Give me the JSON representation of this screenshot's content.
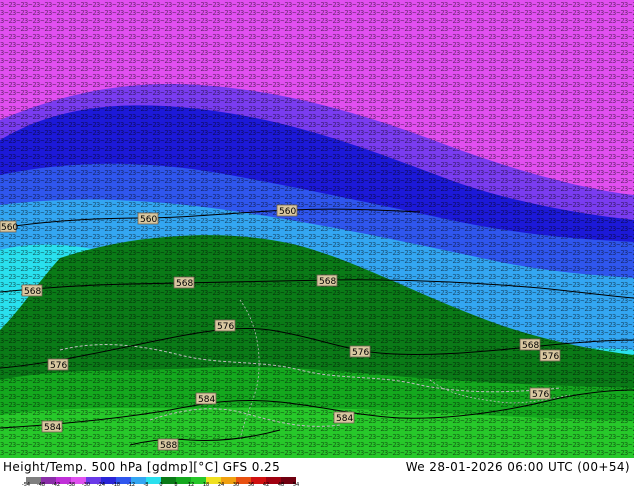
{
  "map": {
    "contour_labels": [
      "560",
      "560",
      "560",
      "568",
      "568",
      "568",
      "576",
      "576",
      "576",
      "576",
      "568",
      "576",
      "584",
      "584",
      "584",
      "588"
    ],
    "band_colors": {
      "magenta": "#e14ff0",
      "violet": "#7a3cf0",
      "blue_dark": "#1c19d8",
      "blue": "#2f56ee",
      "sky": "#33a6f2",
      "cyan": "#29e0ee",
      "green_dark": "#0a7a17",
      "green": "#14a81e",
      "green_light": "#27c82a"
    }
  },
  "footer": {
    "title_left": "Height/Temp. 500 hPa [gdmp][°C] GFS 0.25",
    "title_right": "We 28-01-2026 06:00 UTC (00+54)",
    "colorbar_ticks": [
      "-54",
      "-48",
      "-42",
      "-38",
      "-30",
      "-24",
      "-18",
      "-12",
      "-8",
      "0",
      "8",
      "12",
      "18",
      "24",
      "30",
      "36",
      "42",
      "48",
      "54"
    ],
    "colorbar_colors": [
      "#7f7f7f",
      "#8a2ea8",
      "#c030d8",
      "#e050f0",
      "#6a3ae8",
      "#2a25d8",
      "#2f56ee",
      "#33a6f2",
      "#29e0ee",
      "#0a7a17",
      "#14a81e",
      "#27c82a",
      "#f0e020",
      "#f0a010",
      "#e85010",
      "#d01010",
      "#a00010",
      "#700010"
    ]
  }
}
